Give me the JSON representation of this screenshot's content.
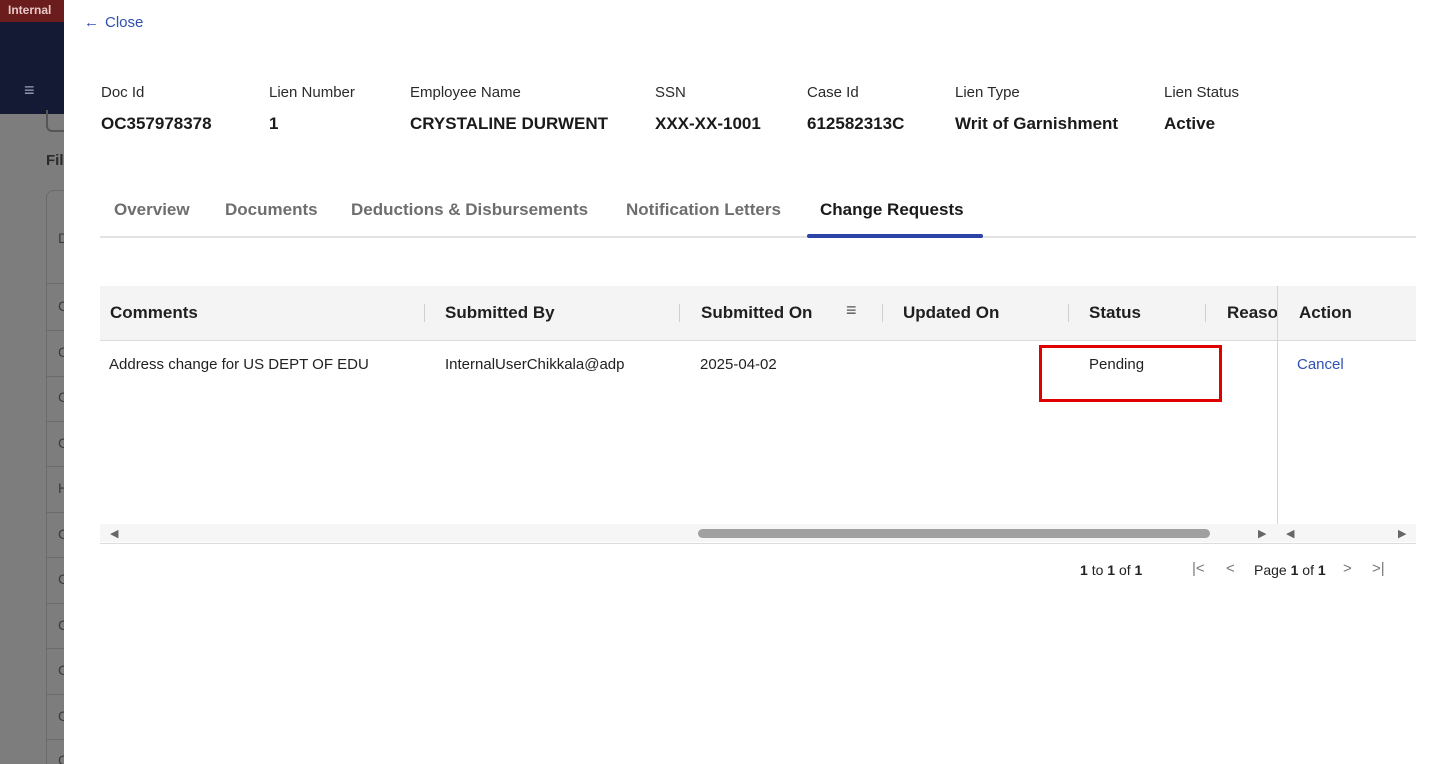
{
  "background": {
    "banner_text": "Internal",
    "filter_label": "Fil",
    "row_letters": [
      "D",
      "C",
      "C",
      "C",
      "C",
      "H",
      "C",
      "C",
      "C",
      "C",
      "C",
      "C"
    ]
  },
  "modal": {
    "close_label": "Close",
    "info": [
      {
        "label": "Doc Id",
        "value": "OC357978378"
      },
      {
        "label": "Lien Number",
        "value": "1"
      },
      {
        "label": "Employee Name",
        "value": "CRYSTALINE DURWENT"
      },
      {
        "label": "SSN",
        "value": "XXX-XX-1001"
      },
      {
        "label": "Case Id",
        "value": "612582313C"
      },
      {
        "label": "Lien Type",
        "value": "Writ of Garnishment"
      },
      {
        "label": "Lien Status",
        "value": "Active"
      }
    ],
    "tabs": [
      {
        "label": "Overview",
        "active": false
      },
      {
        "label": "Documents",
        "active": false
      },
      {
        "label": "Deductions & Disbursements",
        "active": false
      },
      {
        "label": "Notification Letters",
        "active": false
      },
      {
        "label": "Change Requests",
        "active": true
      }
    ],
    "grid": {
      "columns": [
        "Comments",
        "Submitted By",
        "Submitted On",
        "Updated On",
        "Status",
        "Reaso",
        "Action"
      ],
      "rows": [
        {
          "comments": "Address change for US DEPT OF EDU",
          "submitted_by": "InternalUserChikkala@adp",
          "submitted_on": "2025-04-02",
          "updated_on": "",
          "status": "Pending",
          "reason": "",
          "action": "Cancel"
        }
      ]
    },
    "pagination": {
      "from": "1",
      "to": "1",
      "of": "1",
      "page": "1",
      "page_count": "1",
      "to_word": "to",
      "of_word": "of",
      "page_word": "Page"
    }
  },
  "colors": {
    "accent": "#2b44a6",
    "link": "#2f4fb3",
    "highlight": "#e00000"
  }
}
